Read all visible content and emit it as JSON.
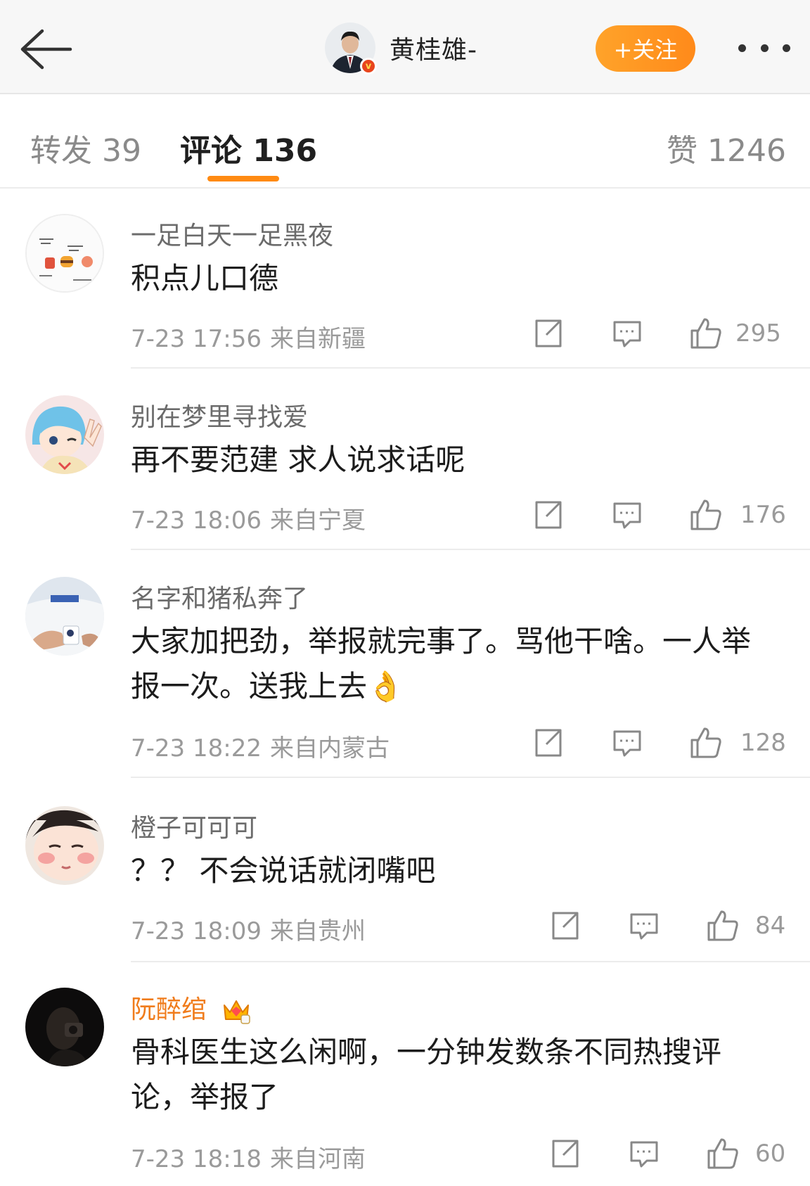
{
  "header": {
    "author_name": "黄桂雄-",
    "follow_label": "+关注"
  },
  "tabs": [
    {
      "label": "转发 39"
    },
    {
      "label": "评论 136"
    },
    {
      "label": "赞 1246"
    }
  ],
  "comments": [
    {
      "user": "一足白天一足黑夜",
      "text": "积点儿口德",
      "time": "7-23 17:56",
      "location": "来自新疆",
      "likes": "295"
    },
    {
      "user": "别在梦里寻找爱",
      "text": "再不要范建 求人说求话呢",
      "time": "7-23 18:06",
      "location": "来自宁夏",
      "likes": "176"
    },
    {
      "user": "名字和猪私奔了",
      "text": "大家加把劲，举报就完事了。骂他干啥。一人举报一次。送我上去👌",
      "time": "7-23 18:22",
      "location": "来自内蒙古",
      "likes": "128"
    },
    {
      "user": "橙子可可可",
      "text": "？？ 不会说话就闭嘴吧",
      "time": "7-23 18:09",
      "location": "来自贵州",
      "likes": "84"
    },
    {
      "user": "阮醉绾",
      "text": "骨科医生这么闲啊，一分钟发数条不同热搜评论，举报了",
      "time": "7-23 18:18",
      "location": "来自河南",
      "likes": "60"
    }
  ],
  "colors": {
    "accent": "#ff8a12",
    "vip_name": "#f07c1c"
  }
}
